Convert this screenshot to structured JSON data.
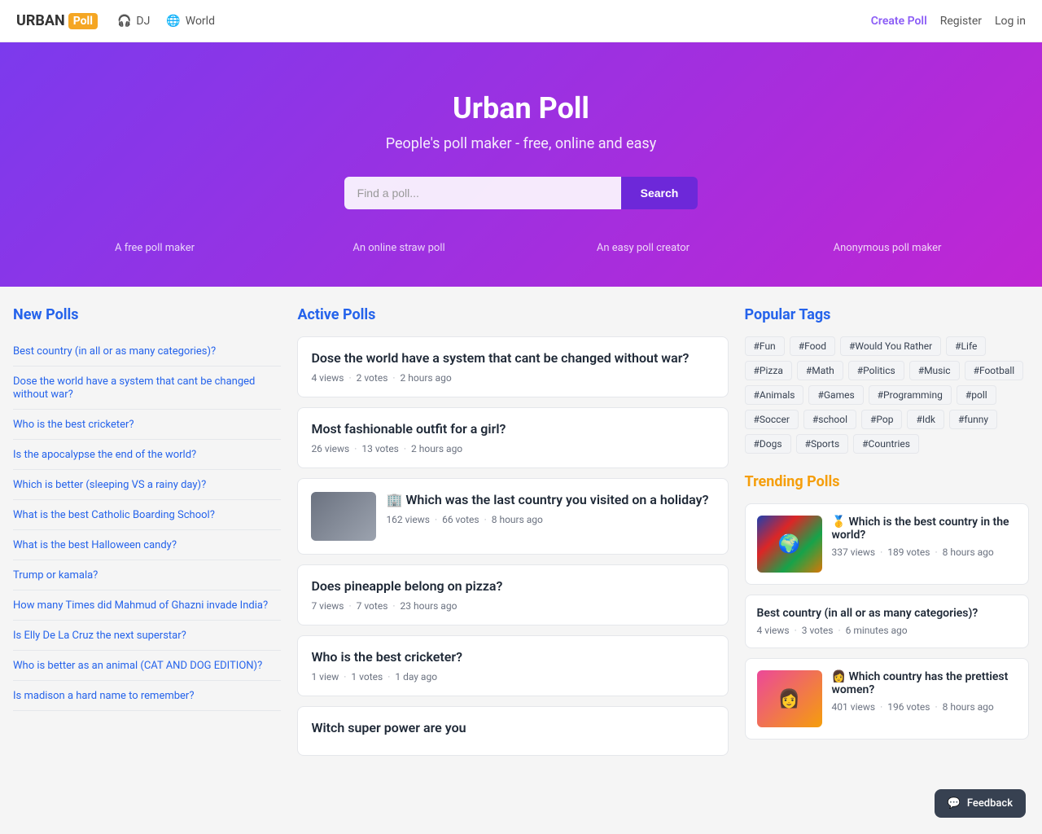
{
  "brand": {
    "name_urban": "URBAN",
    "name_poll": "Poll"
  },
  "navbar": {
    "dj_label": "DJ",
    "world_label": "World",
    "create_poll": "Create Poll",
    "register": "Register",
    "login": "Log in"
  },
  "hero": {
    "title": "Urban Poll",
    "subtitle": "People's poll maker - free, online and easy",
    "search_placeholder": "Find a poll...",
    "search_button": "Search",
    "features": [
      "A free poll maker",
      "An online straw poll",
      "An easy poll creator",
      "Anonymous poll maker"
    ]
  },
  "new_polls": {
    "section_title": "New Polls",
    "items": [
      {
        "title": "Best country (in all or as many categories)?"
      },
      {
        "title": "Dose the world have a system that cant be changed without war?"
      },
      {
        "title": "Who is the best cricketer?"
      },
      {
        "title": "Is the apocalypse the end of the world?"
      },
      {
        "title": "Which is better (sleeping VS a rainy day)?"
      },
      {
        "title": "What is the best Catholic Boarding School?"
      },
      {
        "title": "What is the best Halloween candy?"
      },
      {
        "title": "Trump or kamala?"
      },
      {
        "title": "How many Times did Mahmud of Ghazni invade India?"
      },
      {
        "title": "Is Elly De La Cruz the next superstar?"
      },
      {
        "title": "Who is better as an animal (CAT AND DOG EDITION)?"
      },
      {
        "title": "Is madison a hard name to remember?"
      }
    ]
  },
  "active_polls": {
    "section_title": "Active Polls",
    "items": [
      {
        "title": "Dose the world have a system that cant be changed without war?",
        "views": "4 views",
        "votes": "2 votes",
        "time": "2 hours ago",
        "has_image": false
      },
      {
        "title": "Most fashionable outfit for a girl?",
        "views": "26 views",
        "votes": "13 votes",
        "time": "2 hours ago",
        "has_image": false
      },
      {
        "title": "🏢 Which was the last country you visited on a holiday?",
        "views": "162 views",
        "votes": "66 votes",
        "time": "8 hours ago",
        "has_image": true
      },
      {
        "title": "Does pineapple belong on pizza?",
        "views": "7 views",
        "votes": "7 votes",
        "time": "23 hours ago",
        "has_image": false
      },
      {
        "title": "Who is the best cricketer?",
        "views": "1 view",
        "votes": "1 votes",
        "time": "1 day ago",
        "has_image": false
      },
      {
        "title": "Witch super power are you",
        "views": "",
        "votes": "",
        "time": "",
        "has_image": false
      }
    ]
  },
  "popular_tags": {
    "section_title": "Popular Tags",
    "tags": [
      "#Fun",
      "#Food",
      "#Would You Rather",
      "#Life",
      "#Pizza",
      "#Math",
      "#Politics",
      "#Music",
      "#Football",
      "#Animals",
      "#Games",
      "#Programming",
      "#poll",
      "#Soccer",
      "#school",
      "#Pop",
      "#Idk",
      "#funny",
      "#Dogs",
      "#Sports",
      "#Countries"
    ]
  },
  "trending_polls": {
    "section_title": "Trending Polls",
    "items": [
      {
        "title": "🥇 Which is the best country in the world?",
        "views": "337 views",
        "votes": "189 votes",
        "time": "8 hours ago",
        "thumb_type": "flags"
      },
      {
        "title": "Best country (in all or as many categories)?",
        "views": "4 views",
        "votes": "3 votes",
        "time": "6 minutes ago",
        "thumb_type": "none"
      },
      {
        "title": "👩 Which country has the prettiest women?",
        "views": "401 views",
        "votes": "196 votes",
        "time": "8 hours ago",
        "thumb_type": "woman"
      }
    ]
  },
  "feedback": {
    "label": "Feedback"
  }
}
